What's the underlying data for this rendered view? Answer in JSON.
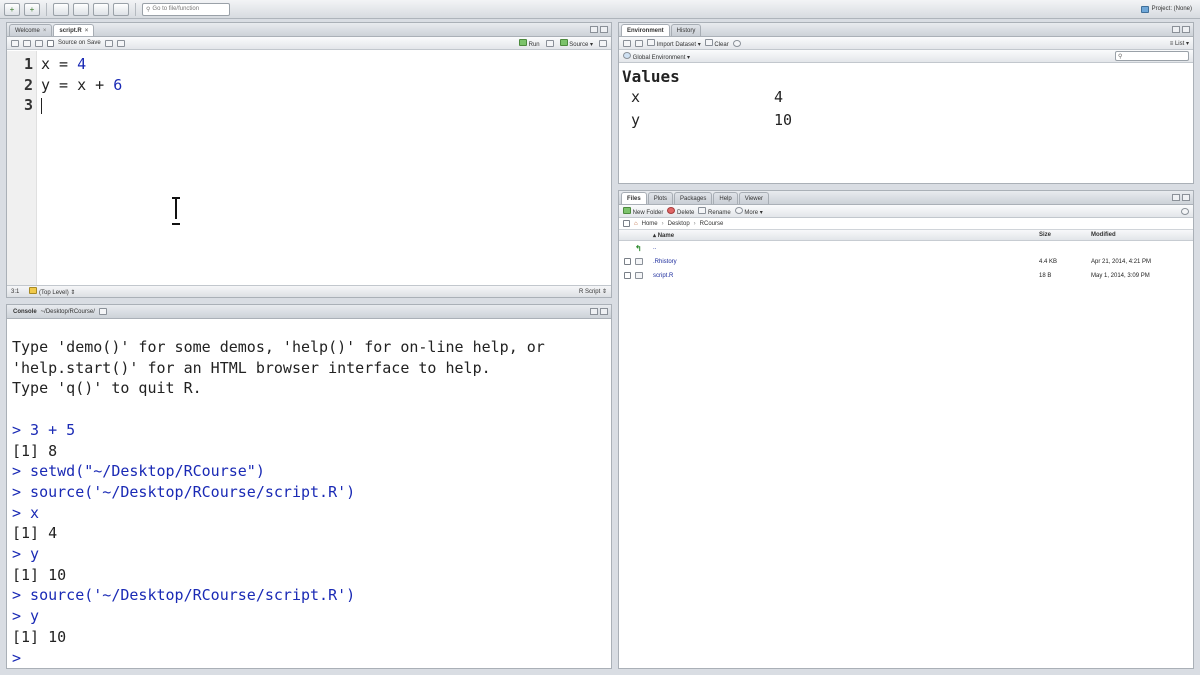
{
  "topbar": {
    "goto_placeholder": "Go to file/function",
    "project_label": "Project: (None)"
  },
  "editor": {
    "tabs": [
      {
        "label": "Welcome",
        "active": false
      },
      {
        "label": "script.R",
        "active": true
      }
    ],
    "source_on_save": "Source on Save",
    "run_label": "Run",
    "source_label": "Source",
    "line_numbers": [
      "1",
      "2",
      "3"
    ],
    "lines": [
      {
        "pre": "x = ",
        "num": "4",
        "post": ""
      },
      {
        "pre": "y = x + ",
        "num": "6",
        "post": ""
      },
      {
        "pre": "",
        "num": "",
        "post": ""
      }
    ],
    "status_position": "3:1",
    "status_scope": "(Top Level)",
    "status_filetype": "R Script"
  },
  "console": {
    "title": "Console",
    "path": "~/Desktop/RCourse/",
    "lines": [
      {
        "text": "Type 'demo()' for some demos, 'help()' for on-line help, or",
        "cls": "out"
      },
      {
        "text": "'help.start()' for an HTML browser interface to help.",
        "cls": "out"
      },
      {
        "text": "Type 'q()' to quit R.",
        "cls": "out"
      },
      {
        "text": "",
        "cls": "out"
      },
      {
        "text": "> 3 + 5",
        "cls": "cmd"
      },
      {
        "text": "[1] 8",
        "cls": "out"
      },
      {
        "text": "> setwd(\"~/Desktop/RCourse\")",
        "cls": "cmd"
      },
      {
        "text": "> source('~/Desktop/RCourse/script.R')",
        "cls": "cmd"
      },
      {
        "text": "> x",
        "cls": "cmd"
      },
      {
        "text": "[1] 4",
        "cls": "out"
      },
      {
        "text": "> y",
        "cls": "cmd"
      },
      {
        "text": "[1] 10",
        "cls": "out"
      },
      {
        "text": "> source('~/Desktop/RCourse/script.R')",
        "cls": "cmd"
      },
      {
        "text": "> y",
        "cls": "cmd"
      },
      {
        "text": "[1] 10",
        "cls": "out"
      },
      {
        "text": ">",
        "cls": "cmd"
      }
    ]
  },
  "environment": {
    "tabs": [
      {
        "label": "Environment",
        "active": true
      },
      {
        "label": "History",
        "active": false
      }
    ],
    "import_label": "Import Dataset",
    "clear_label": "Clear",
    "list_label": "List",
    "scope_label": "Global Environment",
    "section_title": "Values",
    "variables": [
      {
        "name": "x",
        "value": "4"
      },
      {
        "name": "y",
        "value": "10"
      }
    ]
  },
  "files": {
    "tabs": [
      {
        "label": "Files",
        "active": true
      },
      {
        "label": "Plots",
        "active": false
      },
      {
        "label": "Packages",
        "active": false
      },
      {
        "label": "Help",
        "active": false
      },
      {
        "label": "Viewer",
        "active": false
      }
    ],
    "new_folder": "New Folder",
    "delete": "Delete",
    "rename": "Rename",
    "more": "More",
    "breadcrumb": [
      "Home",
      "Desktop",
      "RCourse"
    ],
    "columns": {
      "name": "Name",
      "size": "Size",
      "modified": "Modified"
    },
    "up_label": "..",
    "rows": [
      {
        "name": ".Rhistory",
        "size": "4.4 KB",
        "modified": "Apr 21, 2014, 4:21 PM"
      },
      {
        "name": "script.R",
        "size": "18 B",
        "modified": "May 1, 2014, 3:09 PM"
      }
    ]
  },
  "colors": {
    "number": "#1a2ab5",
    "command": "#1a2ab5",
    "file_link": "#1a2a9c"
  }
}
